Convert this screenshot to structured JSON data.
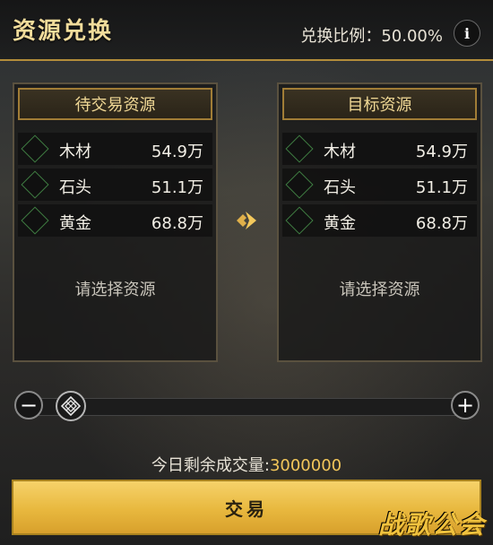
{
  "title": "资源兑换",
  "ratio": "兑换比例：50.00%",
  "info_label": "i",
  "left_panel": {
    "header": "待交易资源",
    "rows": [
      {
        "name": "木材",
        "amount": "54.9万"
      },
      {
        "name": "石头",
        "amount": "51.1万"
      },
      {
        "name": "黄金",
        "amount": "68.8万"
      }
    ],
    "placeholder": "请选择资源"
  },
  "right_panel": {
    "header": "目标资源",
    "rows": [
      {
        "name": "木材",
        "amount": "54.9万"
      },
      {
        "name": "石头",
        "amount": "51.1万"
      },
      {
        "name": "黄金",
        "amount": "68.8万"
      }
    ],
    "placeholder": "请选择资源"
  },
  "slider": {
    "minus": "−",
    "plus": "+",
    "value": 0
  },
  "remaining": {
    "label": "今日剩余成交量:",
    "value": "3000000"
  },
  "trade_button": "交易",
  "watermark": "战歌公会",
  "colors": {
    "accent": "#f1dc9b",
    "button": "#e8b83e",
    "frame": "#a17d36"
  }
}
